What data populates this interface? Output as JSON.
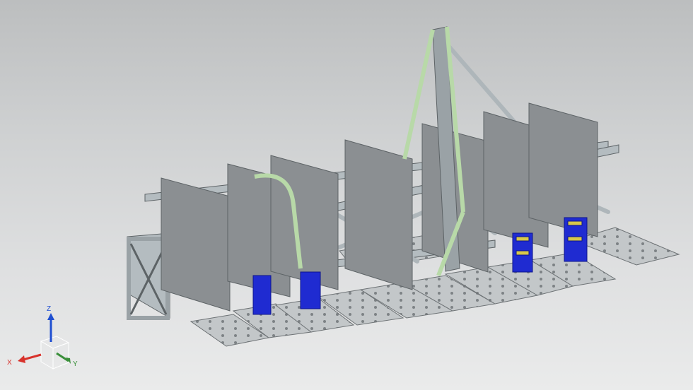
{
  "viewport": {
    "background_top": "#bcbebf",
    "background_bottom": "#eaebeb",
    "model": {
      "frame_color": "#b4bcc0",
      "panel_color": "#8b8f92",
      "tube_highlight_color": "#b8d9a8",
      "clamp_color": "#1f2bd1",
      "clamp_accent_color": "#d8c84a",
      "base_plate_color": "#c3c7c9"
    }
  },
  "triad": {
    "x_label": "X",
    "y_label": "Y",
    "z_label": "Z",
    "x_color": "#d8322b",
    "y_color": "#3a8f3a",
    "z_color": "#1f4fd1"
  }
}
